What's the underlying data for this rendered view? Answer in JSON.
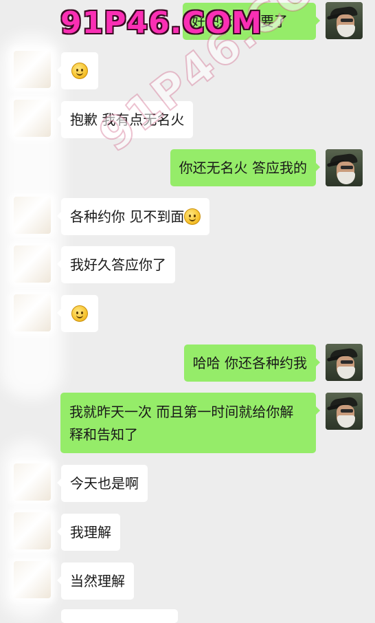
{
  "watermark": {
    "top_text": "91P46.COM",
    "diagonal_text": "91P46.COM"
  },
  "messages": [
    {
      "side": "out",
      "text": "好吧老子不要了"
    },
    {
      "side": "in",
      "emoji": "smile-emoji"
    },
    {
      "side": "in",
      "text": "抱歉 我有点无名火"
    },
    {
      "side": "out",
      "text": "你还无名火 答应我的"
    },
    {
      "side": "in",
      "text": "各种约你 见不到面",
      "emoji": "smile-emoji"
    },
    {
      "side": "in",
      "text": "我好久答应你了"
    },
    {
      "side": "in",
      "emoji": "smile-emoji"
    },
    {
      "side": "out",
      "text": "哈哈 你还各种约我"
    },
    {
      "side": "out",
      "text": "我就昨天一次 而且第一时间就给你解释和告知了"
    },
    {
      "side": "in",
      "text": "今天也是啊"
    },
    {
      "side": "in",
      "text": "我理解"
    },
    {
      "side": "in",
      "text": "当然理解"
    }
  ],
  "colors": {
    "background": "#ededed",
    "incoming_bubble": "#ffffff",
    "outgoing_bubble": "#95ec69",
    "watermark_pink": "#fa2fb4"
  }
}
